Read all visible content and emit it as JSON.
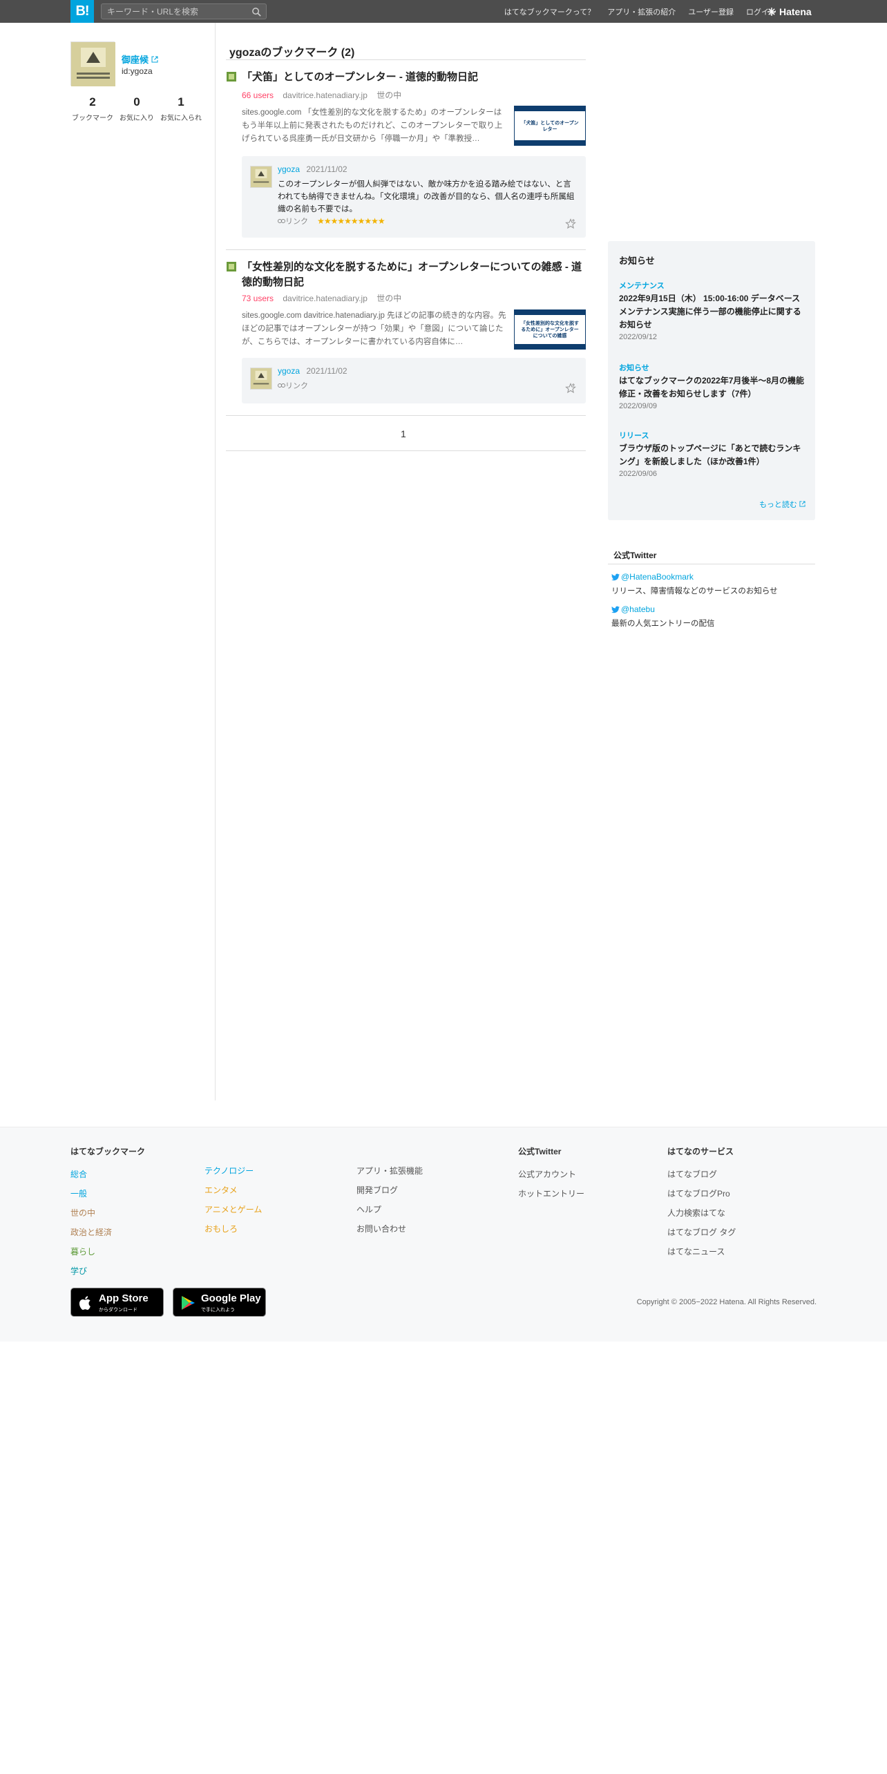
{
  "header": {
    "logo": "B!",
    "search_placeholder": "キーワード・URLを検索",
    "nav": [
      "はてなブックマークって？",
      "アプリ・拡張の紹介",
      "ユーザー登録",
      "ログイン"
    ],
    "brand": "Hatena"
  },
  "profile": {
    "name": "御座候",
    "id": "id:ygoza",
    "stats": [
      {
        "value": "2",
        "label": "ブックマーク"
      },
      {
        "value": "0",
        "label": "お気に入り"
      },
      {
        "value": "1",
        "label": "お気に入られ"
      }
    ]
  },
  "main": {
    "title": "ygozaのブックマーク (2)",
    "entries": [
      {
        "title": "「犬笛」としてのオープンレター - 道徳的動物日記",
        "users": "66 users",
        "domain": "davitrice.hatenadiary.jp",
        "category": "世の中",
        "snippet": "sites.google.com 「女性差別的な文化を脱するため」のオープンレターはもう半年以上前に発表されたものだけれど、このオープンレターで取り上げられている呉座勇一氏が日文研から「停職一か月」や「準教授…",
        "thumb_title": "「犬笛」としてのオープンレター",
        "comment": {
          "user": "ygoza",
          "date": "2021/11/02",
          "text": "このオープンレターが個人糾弾ではない、敵か味方かを迫る踏み絵ではない、と言われても納得できませんね。「文化環境」の改善が目的なら、個人名の連呼も所属組織の名前も不要では。",
          "link": "リンク",
          "stars": "★★★★★★★★★★"
        }
      },
      {
        "title": "「女性差別的な文化を脱するために」オープンレターについての雑感 - 道徳的動物日記",
        "users": "73 users",
        "domain": "davitrice.hatenadiary.jp",
        "category": "世の中",
        "snippet": "sites.google.com davitrice.hatenadiary.jp 先ほどの記事の続き的な内容。先ほどの記事ではオープンレターが持つ「効果」や「意図」について論じたが、こちらでは、オープンレターに書かれている内容自体に…",
        "thumb_title": "「女性差別的な文化を脱するために」オープンレターについての雑感",
        "comment": {
          "user": "ygoza",
          "date": "2021/11/02",
          "text": "",
          "link": "リンク",
          "stars": ""
        }
      }
    ],
    "page": "1"
  },
  "news": {
    "heading": "お知らせ",
    "items": [
      {
        "category": "メンテナンス",
        "title": "2022年9月15日（木） 15:00-16:00 データベースメンテナンス実施に伴う一部の機能停止に関するお知らせ",
        "date": "2022/09/12"
      },
      {
        "category": "お知らせ",
        "title": "はてなブックマークの2022年7月後半〜8月の機能修正・改善をお知らせします（7件）",
        "date": "2022/09/09"
      },
      {
        "category": "リリース",
        "title": "ブラウザ版のトップページに「あとで読むランキング」を新設しました（ほか改善1件）",
        "date": "2022/09/06"
      }
    ],
    "more": "もっと読む"
  },
  "twitter": {
    "heading": "公式Twitter",
    "accounts": [
      {
        "handle": "@HatenaBookmark",
        "desc": "リリース、障害情報などのサービスのお知らせ"
      },
      {
        "handle": "@hatebu",
        "desc": "最新の人気エントリーの配信"
      }
    ]
  },
  "footer": {
    "col1_heading": "はてなブックマーク",
    "col1a": [
      "総合",
      "一般",
      "世の中",
      "政治と経済",
      "暮らし",
      "学び"
    ],
    "col1b": [
      "テクノロジー",
      "エンタメ",
      "アニメとゲーム",
      "おもしろ"
    ],
    "col1c": [
      "アプリ・拡張機能",
      "開発ブログ",
      "ヘルプ",
      "お問い合わせ"
    ],
    "col2_heading": "公式Twitter",
    "col2": [
      "公式アカウント",
      "ホットエントリー"
    ],
    "col3_heading": "はてなのサービス",
    "col3": [
      "はてなブログ",
      "はてなブログPro",
      "人力検索はてな",
      "はてなブログ タグ",
      "はてなニュース"
    ],
    "appstore": {
      "main": "App Store",
      "sub": "からダウンロード"
    },
    "googleplay": {
      "main": "Google Play",
      "sub": "で手に入れよう"
    },
    "copyright": "Copyright © 2005−2022 Hatena. All Rights Reserved."
  },
  "colors": {
    "accent": "#00a4de",
    "users": "#ff4166",
    "header_bg": "#4d4d4d",
    "cat_colors": [
      "#00a4de",
      "#00a4de",
      "#b08153",
      "#b08153",
      "#5f9b3a",
      "#0096a5"
    ],
    "cat_colors_b": [
      "#00a4de",
      "#e8a21b",
      "#e8a21b",
      "#e8a21b"
    ]
  }
}
